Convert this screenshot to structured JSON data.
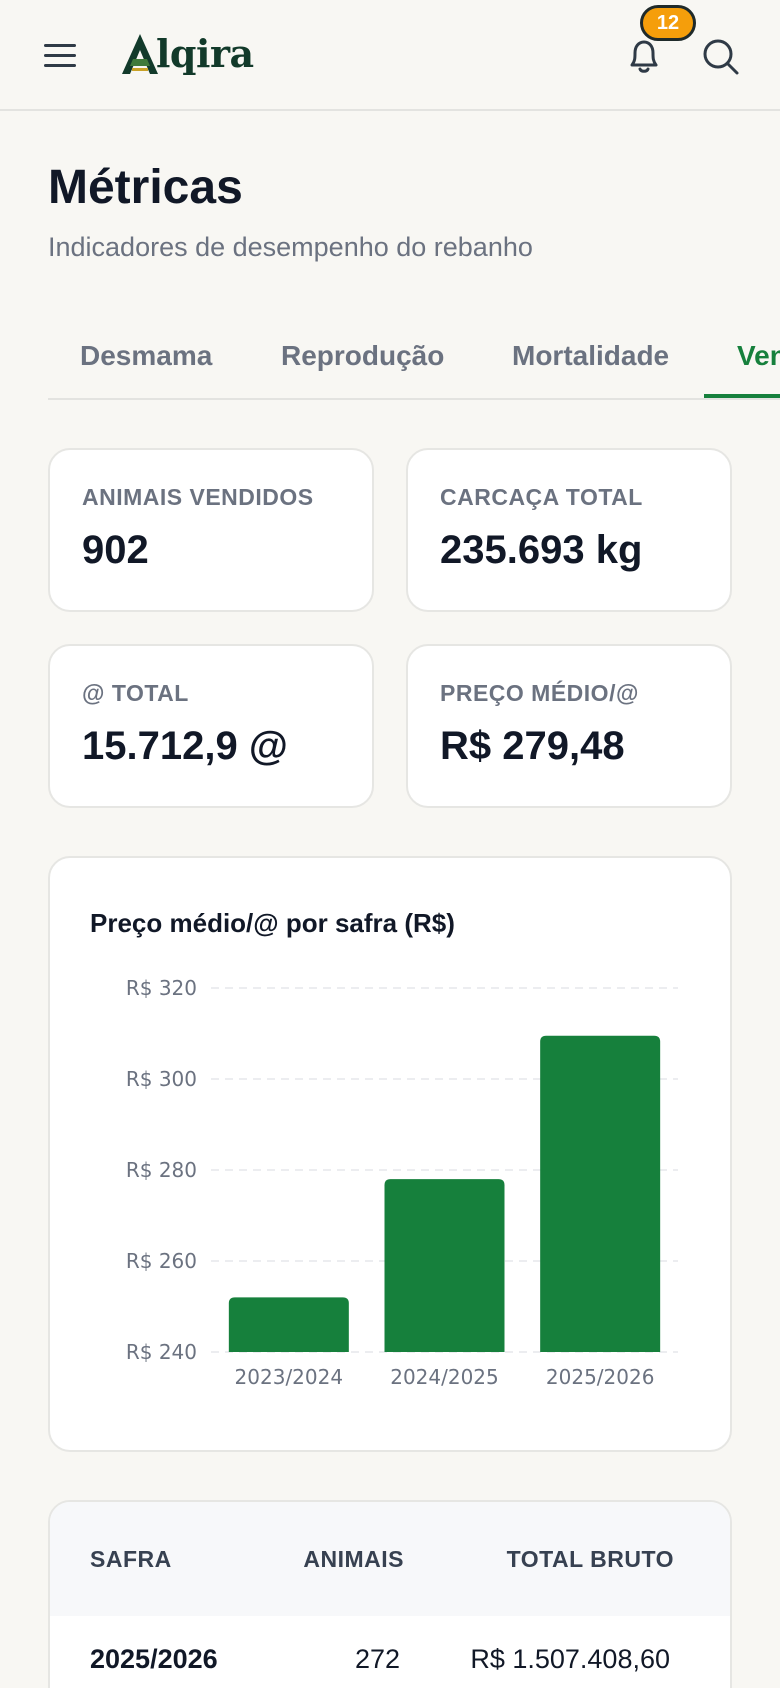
{
  "header": {
    "logo_text": "lqira",
    "notification_count": "12"
  },
  "page": {
    "title": "Métricas",
    "subtitle": "Indicadores de desempenho do rebanho"
  },
  "tabs": [
    {
      "label": "Desmama",
      "active": false
    },
    {
      "label": "Reprodução",
      "active": false
    },
    {
      "label": "Mortalidade",
      "active": false
    },
    {
      "label": "Vendas",
      "active": true
    }
  ],
  "stats": [
    {
      "label": "ANIMAIS VENDIDOS",
      "value": "902"
    },
    {
      "label": "CARCAÇA TOTAL",
      "value": "235.693 kg"
    },
    {
      "label": "@ TOTAL",
      "value": "15.712,9 @"
    },
    {
      "label": "PREÇO MÉDIO/@",
      "value": "R$ 279,48"
    }
  ],
  "chart": {
    "title": "Preço médio/@ por safra (R$)"
  },
  "chart_data": {
    "type": "bar",
    "title": "Preço médio/@ por safra (R$)",
    "categories": [
      "2023/2024",
      "2024/2025",
      "2025/2026"
    ],
    "values": [
      252,
      278,
      309.5
    ],
    "ylim": [
      240,
      320
    ],
    "yticks": [
      240,
      260,
      280,
      300,
      320
    ],
    "ytick_labels": [
      "R$ 240",
      "R$ 260",
      "R$ 280",
      "R$ 300",
      "R$ 320"
    ],
    "bar_color": "#16803c",
    "grid": true
  },
  "table": {
    "headers": [
      "SAFRA",
      "ANIMAIS",
      "TOTAL BRUTO"
    ],
    "rows": [
      {
        "safra": "2025/2026",
        "animais": "272",
        "total": "R$ 1.507.408,60"
      }
    ]
  },
  "colors": {
    "accent": "#16803c",
    "badge": "#f59e0b",
    "background": "#f8f7f3"
  }
}
